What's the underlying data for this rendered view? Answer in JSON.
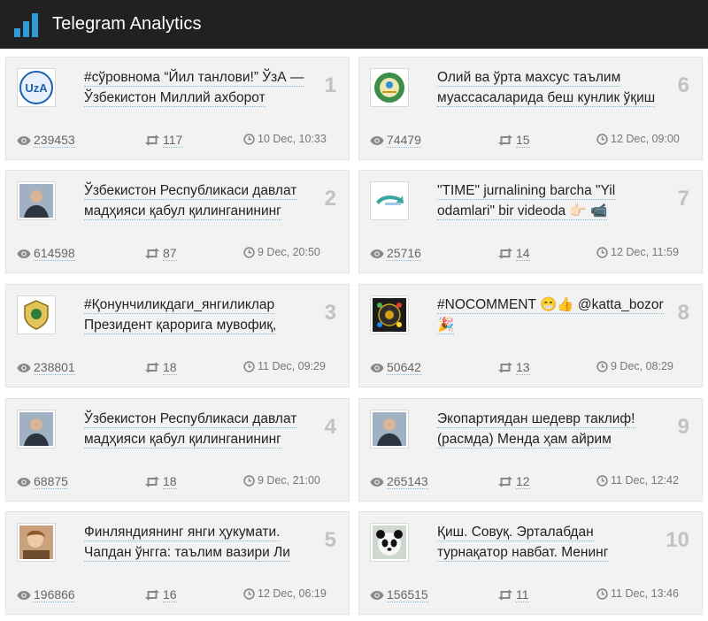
{
  "header": {
    "title": "Telegram Analytics",
    "accent": "#2f9bd6"
  },
  "posts": [
    {
      "rank": "1",
      "title": "#сўровнома “Йил танлови!” ЎзА — Ўзбекистон Миллий ахборот",
      "views": "239453",
      "forwards": "117",
      "date": "10 Dec, 10:33",
      "avatar": "uza-logo"
    },
    {
      "rank": "2",
      "title": "Ўзбекистон Республикаси давлат мадҳияси қабул қилинганининг",
      "views": "614598",
      "forwards": "87",
      "date": "9 Dec, 20:50",
      "avatar": "person-photo"
    },
    {
      "rank": "3",
      "title": "#Қонунчиликдаги_янгиликлар Президент қарорига мувофиқ,",
      "views": "238801",
      "forwards": "18",
      "date": "11 Dec, 09:29",
      "avatar": "emblem-logo"
    },
    {
      "rank": "4",
      "title": "Ўзбекистон Республикаси давлат мадҳияси қабул қилинганининг",
      "views": "68875",
      "forwards": "18",
      "date": "9 Dec, 21:00",
      "avatar": "person-photo"
    },
    {
      "rank": "5",
      "title": "Финляндиянинг янги ҳукумати. Чапдан ўнгга: таълим вазири Ли",
      "views": "196866",
      "forwards": "16",
      "date": "12 Dec, 06:19",
      "avatar": "child-photo"
    },
    {
      "rank": "6",
      "title": "Олий ва ўрта махсус таълим муассасаларида беш кунлик ўқиш",
      "views": "74479",
      "forwards": "15",
      "date": "12 Dec, 09:00",
      "avatar": "state-emblem"
    },
    {
      "rank": "7",
      "title": "\"TIME\" jurnalining barcha \"Yil odamlari\" bir videoda 👉🏻 📹",
      "views": "25716",
      "forwards": "14",
      "date": "12 Dec, 11:59",
      "avatar": "arrow-logo"
    },
    {
      "rank": "8",
      "title": "#NOCOMMENT 😁👍 @katta_bozor 🎉",
      "views": "50642",
      "forwards": "13",
      "date": "9 Dec, 08:29",
      "avatar": "dark-logo"
    },
    {
      "rank": "9",
      "title": "Экопартиядан шедевр таклиф! (расмда) Менда ҳам айрим",
      "views": "265143",
      "forwards": "12",
      "date": "11 Dec, 12:42",
      "avatar": "person-photo"
    },
    {
      "rank": "10",
      "title": "Қиш. Совуқ. Эрталабдан турнақатор навбат. Менинг",
      "views": "156515",
      "forwards": "11",
      "date": "11 Dec, 13:46",
      "avatar": "panda-photo"
    }
  ]
}
